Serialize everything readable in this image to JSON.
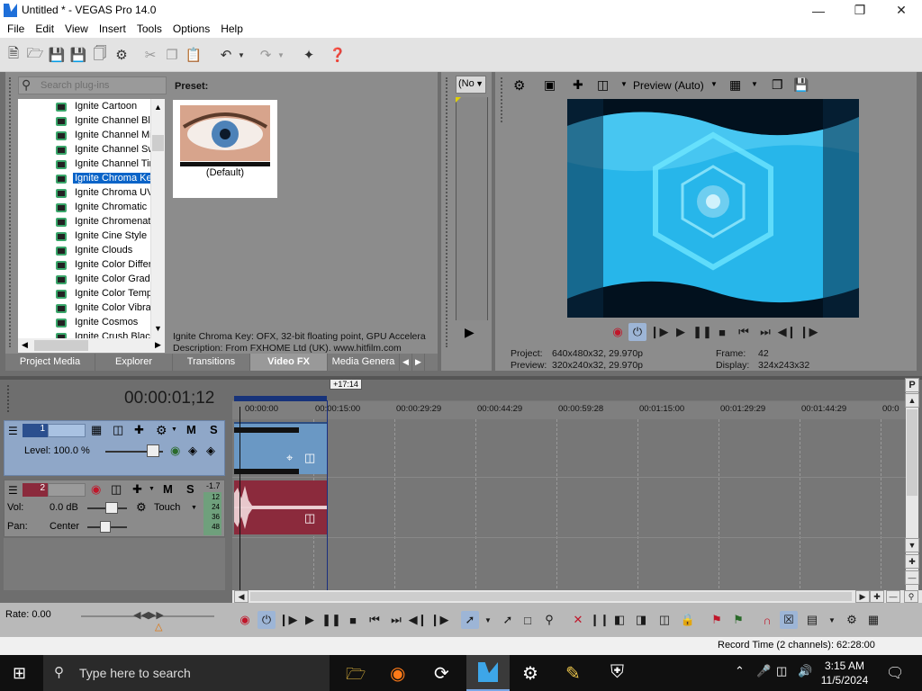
{
  "window": {
    "title": "Untitled * - VEGAS Pro 14.0"
  },
  "menu": [
    "File",
    "Edit",
    "View",
    "Insert",
    "Tools",
    "Options",
    "Help"
  ],
  "plugins": {
    "search_placeholder": "Search plug-ins",
    "items": [
      "Ignite Cartoon",
      "Ignite Channel Blur",
      "Ignite Channel Mixer",
      "Ignite Channel Swap",
      "Ignite Channel Time",
      "Ignite Chroma Key",
      "Ignite Chroma UV",
      "Ignite Chromatic",
      "Ignite Chromenator",
      "Ignite Cine Style",
      "Ignite Clouds",
      "Ignite Color Difference",
      "Ignite Color Gradient",
      "Ignite Color Temperature",
      "Ignite Color Vibrance",
      "Ignite Cosmos",
      "Ignite Crush Black"
    ],
    "selected_index": 5,
    "preset_label": "Preset:",
    "preset_name": "(Default)",
    "info_line1": "Ignite Chroma Key: OFX, 32-bit floating point, GPU Accelera",
    "info_line2": "Description: From FXHOME Ltd (UK). www.hitfilm.com"
  },
  "tabs": [
    "Project Media",
    "Explorer",
    "Transitions",
    "Video FX",
    "Media Genera"
  ],
  "active_tab": "Video FX",
  "trimmer": {
    "dropdown": "(No"
  },
  "preview": {
    "mode": "Preview (Auto)",
    "project_label": "Project:",
    "project_value": "640x480x32, 29.970p",
    "preview_label": "Preview:",
    "preview_value": "320x240x32, 29.970p",
    "frame_label": "Frame:",
    "frame_value": "42",
    "display_label": "Display:",
    "display_value": "324x243x32"
  },
  "timeline": {
    "timecode": "00:00:01;12",
    "region_marker": "+17:14",
    "ruler": [
      "00:00:00",
      "00:00:15:00",
      "00:00:29:29",
      "00:00:44:29",
      "00:00:59:28",
      "00:01:15:00",
      "00:01:29:29",
      "00:01:44:29",
      "00:0"
    ],
    "video_track": {
      "number": "1",
      "level_label": "Level: 100.0 %",
      "mute": "M",
      "solo": "S"
    },
    "audio_track": {
      "number": "2",
      "vol_label": "Vol:",
      "vol_value": "0.0 dB",
      "pan_label": "Pan:",
      "pan_value": "Center",
      "touch": "Touch",
      "mute": "M",
      "solo": "S",
      "meter_peak": "-1.7",
      "meter_scale": [
        "12",
        "24",
        "36",
        "48"
      ]
    }
  },
  "rate": "Rate: 0.00",
  "status": {
    "record_time": "Record Time (2 channels): 62:28:00"
  },
  "taskbar": {
    "search_placeholder": "Type here to search",
    "time": "3:15 AM",
    "date": "11/5/2024"
  },
  "colors": {
    "selection": "#0a64c8",
    "video_clip": "#6a98c4",
    "audio_clip": "#8b2a3c",
    "workspace": "#8c8c8c"
  }
}
